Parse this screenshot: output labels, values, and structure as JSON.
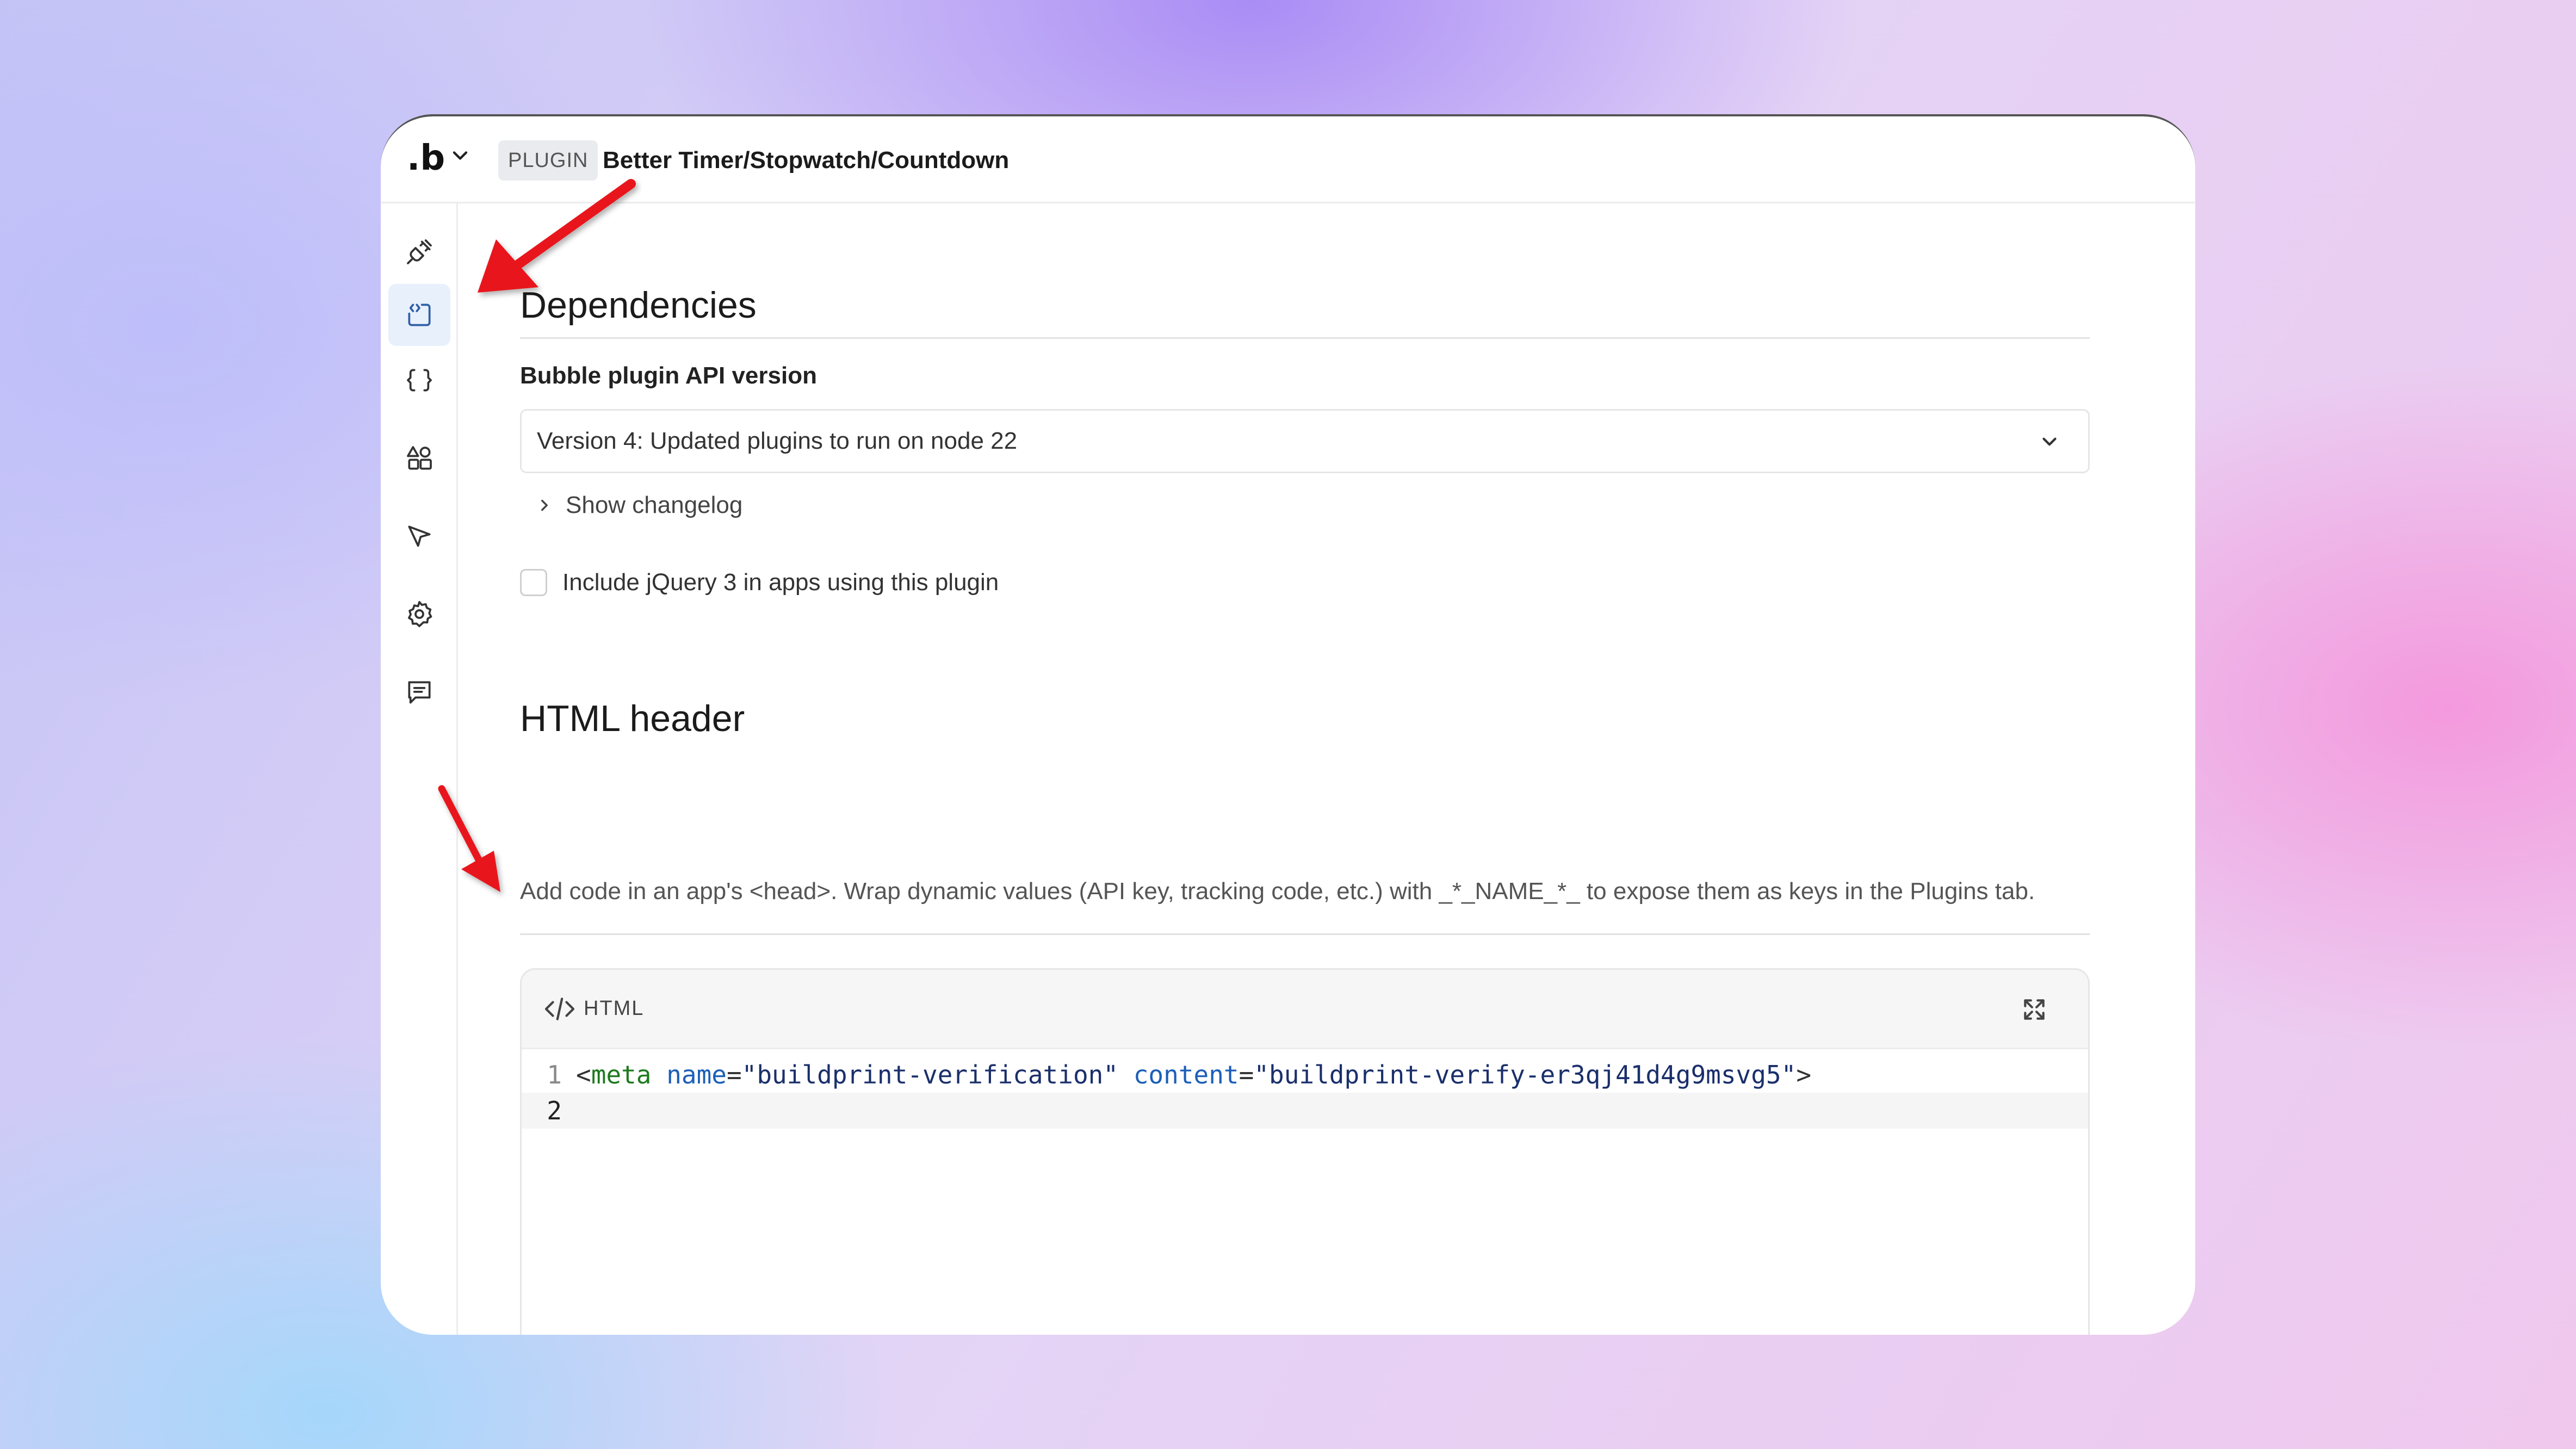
{
  "topbar": {
    "logo": ".b",
    "badge": "PLUGIN",
    "plugin_name": "Better Timer/Stopwatch/Countdown"
  },
  "sidebar": {
    "items": [
      {
        "icon": "plug-icon",
        "active": false
      },
      {
        "icon": "code-file-icon",
        "active": true
      },
      {
        "icon": "braces-icon",
        "active": false
      },
      {
        "icon": "shapes-icon",
        "active": false
      },
      {
        "icon": "cursor-icon",
        "active": false
      },
      {
        "icon": "gear-icon",
        "active": false
      },
      {
        "icon": "message-icon",
        "active": false
      }
    ]
  },
  "dependencies": {
    "title": "Dependencies",
    "api_label": "Bubble plugin API version",
    "api_value": "Version 4: Updated plugins to run on node 22",
    "changelog": "Show changelog",
    "jquery_label": "Include jQuery 3 in apps using this plugin",
    "jquery_checked": false
  },
  "html_header": {
    "title": "HTML header",
    "description": "Add code in an app's <head>. Wrap dynamic values (API key, tracking code, etc.) with _*_NAME_*_ to expose them as keys in the Plugins tab.",
    "editor": {
      "language": "HTML",
      "lines": [
        {
          "number": "1",
          "tokens": [
            {
              "t": "punc",
              "v": "<"
            },
            {
              "t": "tag",
              "v": "meta"
            },
            {
              "t": "punc",
              "v": " "
            },
            {
              "t": "attr",
              "v": "name"
            },
            {
              "t": "punc",
              "v": "="
            },
            {
              "t": "str",
              "v": "\"buildprint-verification\""
            },
            {
              "t": "punc",
              "v": " "
            },
            {
              "t": "attr",
              "v": "content"
            },
            {
              "t": "punc",
              "v": "="
            },
            {
              "t": "str",
              "v": "\"buildprint-verify-er3qj41d4g9msvg5\""
            },
            {
              "t": "punc",
              "v": ">"
            }
          ]
        },
        {
          "number": "2",
          "tokens": []
        }
      ]
    }
  },
  "colors": {
    "accent_active_bg": "#e8f0fb",
    "arrow": "#e8141a"
  }
}
